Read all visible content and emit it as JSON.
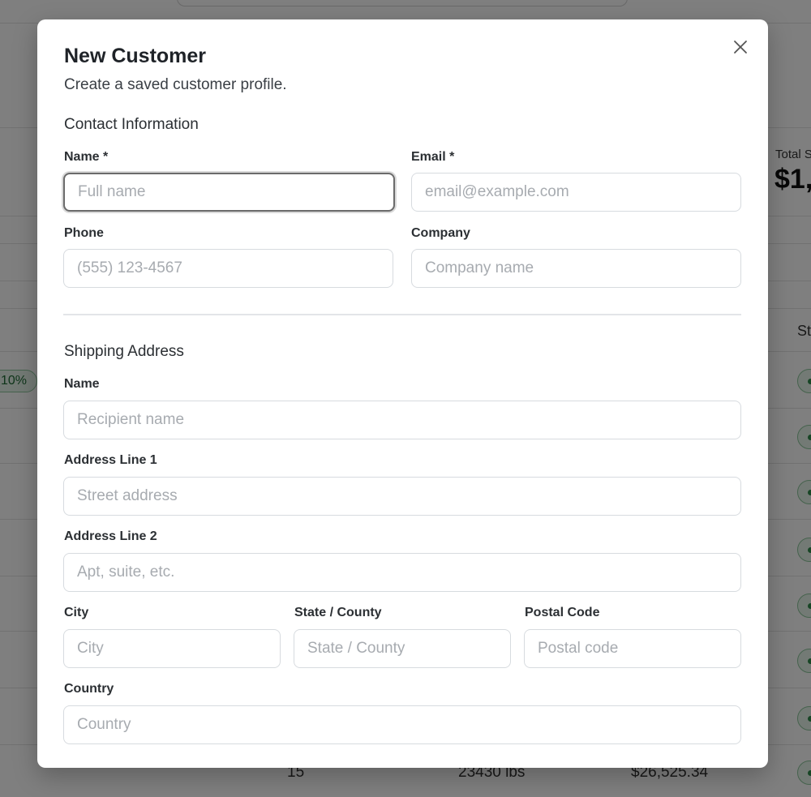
{
  "background": {
    "stat_label": "Total S",
    "stat_value": "$1,",
    "column_header": "St",
    "discount_badge": "10%",
    "row_cells": [
      "15",
      "23430 lbs",
      "$26,525.34"
    ]
  },
  "modal": {
    "title": "New Customer",
    "subtitle": "Create a saved customer profile.",
    "contact": {
      "heading": "Contact Information",
      "name_label": "Name *",
      "name_placeholder": "Full name",
      "email_label": "Email *",
      "email_placeholder": "email@example.com",
      "phone_label": "Phone",
      "phone_placeholder": "(555) 123-4567",
      "company_label": "Company",
      "company_placeholder": "Company name"
    },
    "shipping": {
      "heading": "Shipping Address",
      "name_label": "Name",
      "name_placeholder": "Recipient name",
      "address1_label": "Address Line 1",
      "address1_placeholder": "Street address",
      "address2_label": "Address Line 2",
      "address2_placeholder": "Apt, suite, etc.",
      "city_label": "City",
      "city_placeholder": "City",
      "state_label": "State / County",
      "state_placeholder": "State / County",
      "postal_label": "Postal Code",
      "postal_placeholder": "Postal code",
      "country_label": "Country",
      "country_placeholder": "Country"
    }
  }
}
